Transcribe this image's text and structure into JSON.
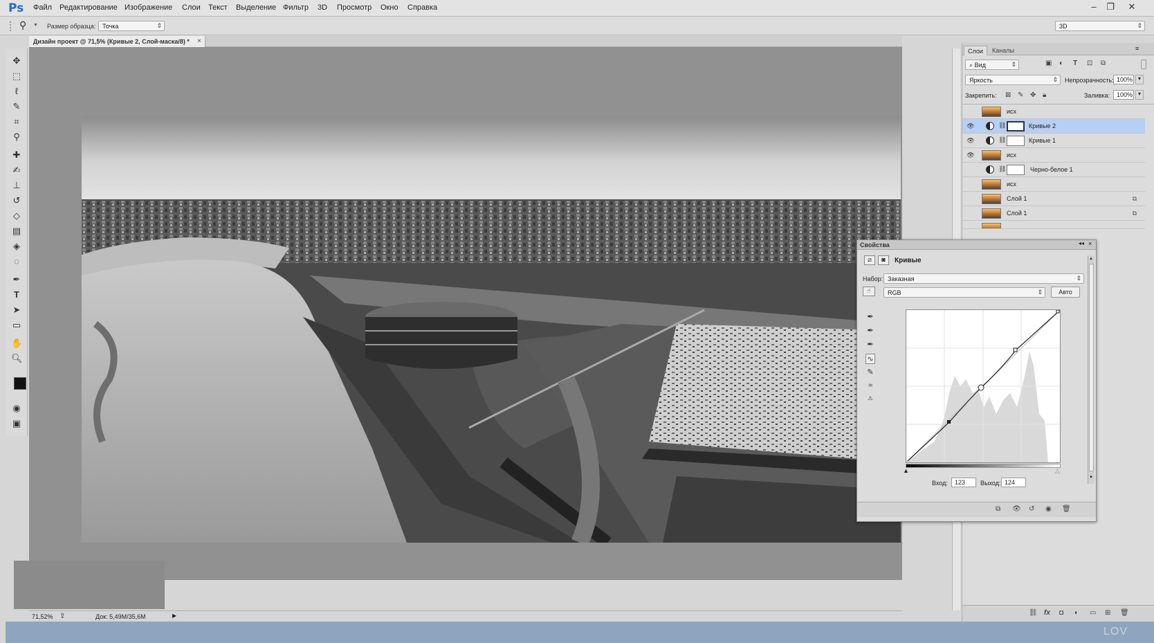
{
  "app": {
    "logo": "Ps"
  },
  "menu": [
    "Файл",
    "Редактирование",
    "Изображение",
    "Слои",
    "Текст",
    "Выделение",
    "Фильтр",
    "3D",
    "Просмотр",
    "Окно",
    "Справка"
  ],
  "window_controls": [
    "–",
    "❐",
    "✕"
  ],
  "options": {
    "sample_size_label": "Размер образца:",
    "sample_size_value": "Точка",
    "workspace_value": "3D"
  },
  "document": {
    "tab_title": "Дизайн проект @ 71,5% (Кривые 2, Слой-маска/8) *",
    "close_glyph": "×"
  },
  "status": {
    "zoom": "71,52%",
    "doc_size": "Док: 5,49M/35,6M"
  },
  "layers_panel": {
    "tabs": [
      "Слои",
      "Каналы"
    ],
    "filter_kind": "Вид",
    "blend_mode": "Яркость",
    "opacity_label": "Непрозрачность:",
    "opacity_value": "100%",
    "lock_label": "Закрепить:",
    "fill_label": "Заливка:",
    "fill_value": "100%",
    "layers": [
      {
        "name": "исх",
        "type": "image",
        "visible": false,
        "selected": false
      },
      {
        "name": "Кривые 2",
        "type": "adjustment",
        "visible": true,
        "selected": true
      },
      {
        "name": "Кривые 1",
        "type": "adjustment",
        "visible": true,
        "selected": false
      },
      {
        "name": "исх",
        "type": "image",
        "visible": true,
        "selected": false
      },
      {
        "name": "Черно-белое 1",
        "type": "adjustment",
        "visible": false,
        "selected": false
      },
      {
        "name": "исх",
        "type": "image",
        "visible": false,
        "selected": false
      },
      {
        "name": "Слой 1",
        "type": "smart",
        "visible": false,
        "selected": false
      },
      {
        "name": "Слой 1",
        "type": "smart",
        "visible": false,
        "selected": false
      }
    ]
  },
  "properties_panel": {
    "tab": "Свойства",
    "title": "Кривые",
    "preset_label": "Набор:",
    "preset_value": "Заказная",
    "channel_value": "RGB",
    "auto_button": "Авто",
    "input_label": "Вход:",
    "input_value": "123",
    "output_label": "Выход:",
    "output_value": "124"
  },
  "taskbar": {
    "watermark": "LOV"
  },
  "colors": {
    "selected_layer": "#b7cff4",
    "workspace": "#919191",
    "taskbar": "#8ea5bf",
    "ps_blue": "#2a6bc2"
  }
}
